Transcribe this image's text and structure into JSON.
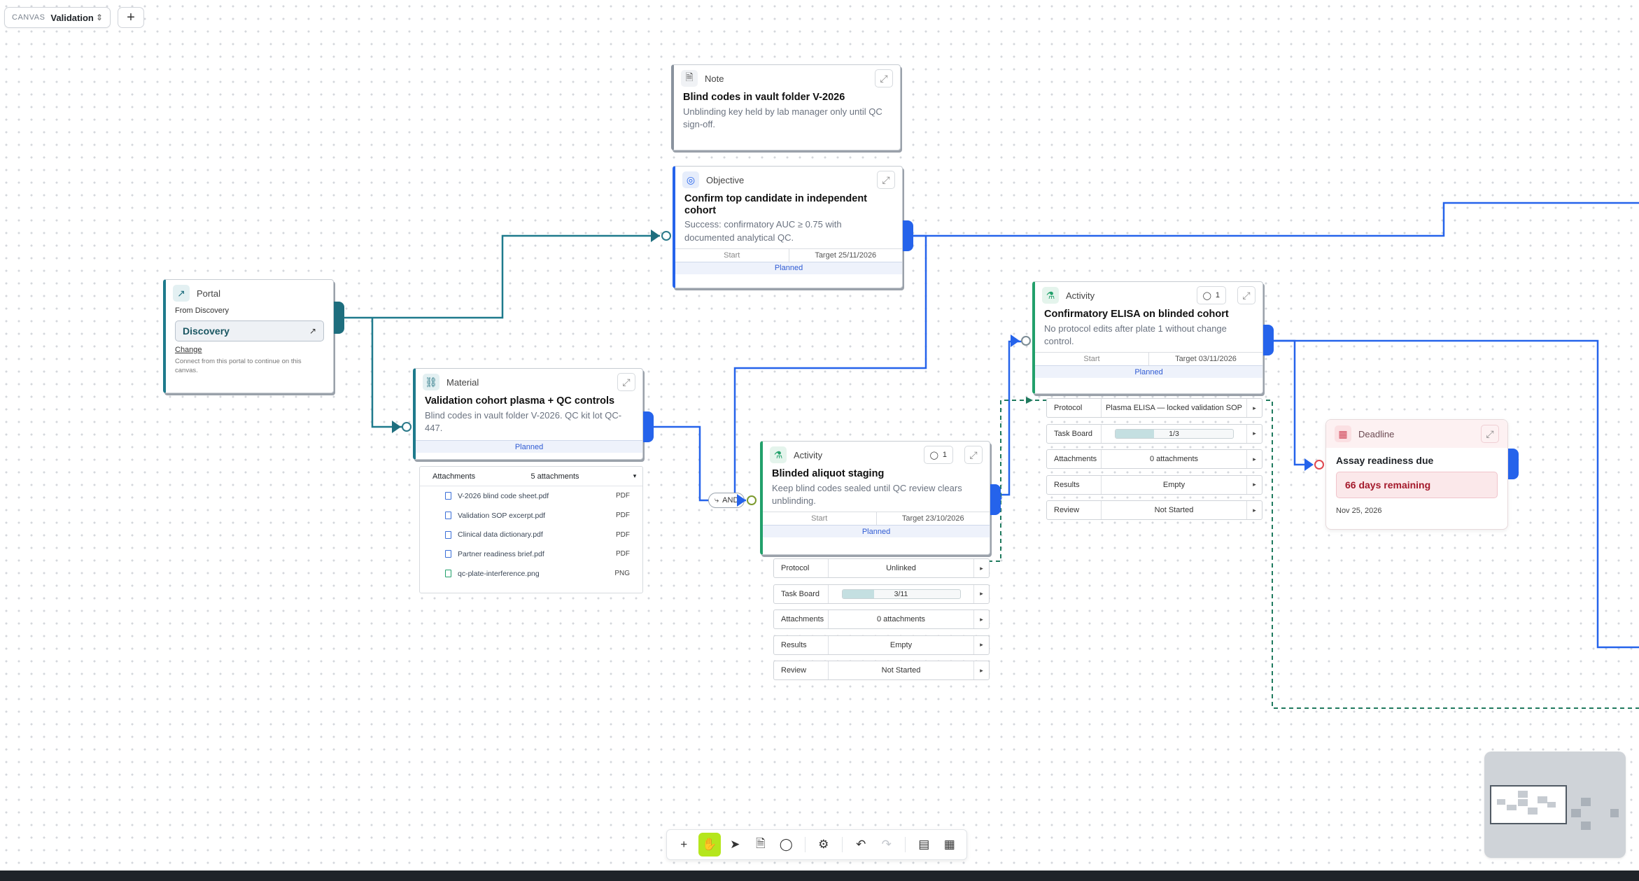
{
  "canvas_select": {
    "label": "CANVAS",
    "value": "Validation"
  },
  "nodes": {
    "note": {
      "type": "Note",
      "title": "Blind codes in vault folder V-2026",
      "desc": "Unblinding key held by lab manager only until QC sign-off."
    },
    "objective": {
      "type": "Objective",
      "title": "Confirm top candidate in independent cohort",
      "desc": "Success: confirmatory AUC ≥ 0.75 with documented analytical QC.",
      "start": "Start",
      "target": "Target 25/11/2026",
      "status": "Planned"
    },
    "portal": {
      "type": "Portal",
      "from": "From Discovery",
      "link": "Discovery",
      "change": "Change",
      "help": "Connect from this portal to continue on this canvas."
    },
    "material": {
      "type": "Material",
      "title": "Validation cohort plasma + QC controls",
      "desc": "Blind codes in vault folder V-2026. QC kit lot QC-447.",
      "status": "Planned",
      "attachments_label": "Attachments",
      "attachments_count": "5 attachments",
      "files": [
        {
          "name": "V-2026 blind code sheet.pdf",
          "ext": "PDF"
        },
        {
          "name": "Validation SOP excerpt.pdf",
          "ext": "PDF"
        },
        {
          "name": "Clinical data dictionary.pdf",
          "ext": "PDF"
        },
        {
          "name": "Partner readiness brief.pdf",
          "ext": "PDF"
        },
        {
          "name": "qc-plate-interference.png",
          "ext": "PNG"
        }
      ]
    },
    "staging": {
      "type": "Activity",
      "comments": "1",
      "title": "Blinded aliquot staging",
      "desc": "Keep blind codes sealed until QC review clears unblinding.",
      "start": "Start",
      "target": "Target 23/10/2026",
      "status": "Planned",
      "props": {
        "protocol_k": "Protocol",
        "protocol_v": "Unlinked",
        "taskboard_k": "Task Board",
        "taskboard_v": "3/11",
        "taskboard_progress": 0.273,
        "attachments_k": "Attachments",
        "attachments_v": "0 attachments",
        "results_k": "Results",
        "results_v": "Empty",
        "review_k": "Review",
        "review_v": "Not Started"
      }
    },
    "elisa": {
      "type": "Activity",
      "comments": "1",
      "title": "Confirmatory ELISA on blinded cohort",
      "desc": "No protocol edits after plate 1 without change control.",
      "start": "Start",
      "target": "Target 03/11/2026",
      "status": "Planned",
      "props": {
        "protocol_k": "Protocol",
        "protocol_v": "Plasma ELISA — locked validation SOP",
        "taskboard_k": "Task Board",
        "taskboard_v": "1/3",
        "taskboard_progress": 0.333,
        "attachments_k": "Attachments",
        "attachments_v": "0 attachments",
        "results_k": "Results",
        "results_v": "Empty",
        "review_k": "Review",
        "review_v": "Not Started"
      }
    },
    "deadline": {
      "type": "Deadline",
      "title": "Assay readiness due",
      "remaining": "66 days remaining",
      "date": "Nov 25, 2026"
    }
  },
  "gate": {
    "label": "AND"
  },
  "colors": {
    "edge_blue": "#2563eb",
    "edge_teal": "#1e7a8c",
    "edge_dashed": "#1f7a5e",
    "active_tool": "#b5e61d"
  },
  "toolbar": {
    "tools": [
      "plus-icon",
      "hand-icon",
      "pointer-icon",
      "sticky-note-icon",
      "comment-icon",
      "settings-icon",
      "undo-icon",
      "redo-icon",
      "layout-icon",
      "calendar-icon"
    ]
  }
}
